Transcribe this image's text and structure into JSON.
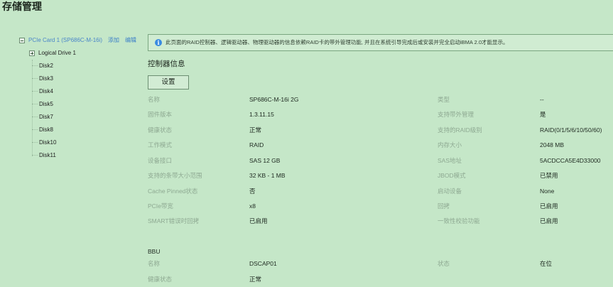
{
  "page": {
    "title": "存储管理"
  },
  "tree": {
    "card": {
      "label": "PCIe Card 1 (SP686C-M-16i)",
      "add_label": "添加",
      "edit_label": "编辑"
    },
    "logical_drive": {
      "label": "Logical Drive 1"
    },
    "disks": [
      "Disk2",
      "Disk3",
      "Disk4",
      "Disk5",
      "Disk7",
      "Disk8",
      "Disk10",
      "Disk11"
    ]
  },
  "notice": {
    "text": "此页面的RAID控制器、逻辑驱动器、物理驱动器的信息依赖RAID卡的带外管理功能, 并且在系统引导完成后或安装并完全启动iBMA 2.0才能显示。"
  },
  "controller": {
    "section_title": "控制器信息",
    "set_button": "设置",
    "left_fields": [
      {
        "label": "名称",
        "value": "SP686C-M-16i 2G"
      },
      {
        "label": "固件版本",
        "value": "1.3.11.15"
      },
      {
        "label": "健康状态",
        "value": "正常"
      },
      {
        "label": "工作模式",
        "value": "RAID"
      },
      {
        "label": "设备接口",
        "value": "SAS 12 GB"
      },
      {
        "label": "支持的条带大小范围",
        "value": "32 KB - 1 MB"
      },
      {
        "label": "Cache Pinned状态",
        "value": "否"
      },
      {
        "label": "PCIe带宽",
        "value": "x8"
      },
      {
        "label": "SMART错误时回拷",
        "value": "已启用"
      }
    ],
    "right_fields": [
      {
        "label": "类型",
        "value": "--"
      },
      {
        "label": "支持带外管理",
        "value": "是"
      },
      {
        "label": "支持的RAID级别",
        "value": "RAID(0/1/5/6/10/50/60)"
      },
      {
        "label": "内存大小",
        "value": "2048 MB"
      },
      {
        "label": "SAS地址",
        "value": "5ACDCCA5E4D33000"
      },
      {
        "label": "JBOD模式",
        "value": "已禁用"
      },
      {
        "label": "启动设备",
        "value": "None"
      },
      {
        "label": "回拷",
        "value": "已启用"
      },
      {
        "label": "一致性校验功能",
        "value": "已启用"
      }
    ]
  },
  "bbu": {
    "title": "BBU",
    "left_fields": [
      {
        "label": "名称",
        "value": "DSCAP01"
      },
      {
        "label": "健康状态",
        "value": "正常"
      }
    ],
    "right_fields": [
      {
        "label": "状态",
        "value": "在位"
      }
    ]
  },
  "colors": {
    "background": "#c5e7c8",
    "link": "#3b7fc8",
    "info_icon": "#3a8be0",
    "label_gray": "#8ea992"
  }
}
